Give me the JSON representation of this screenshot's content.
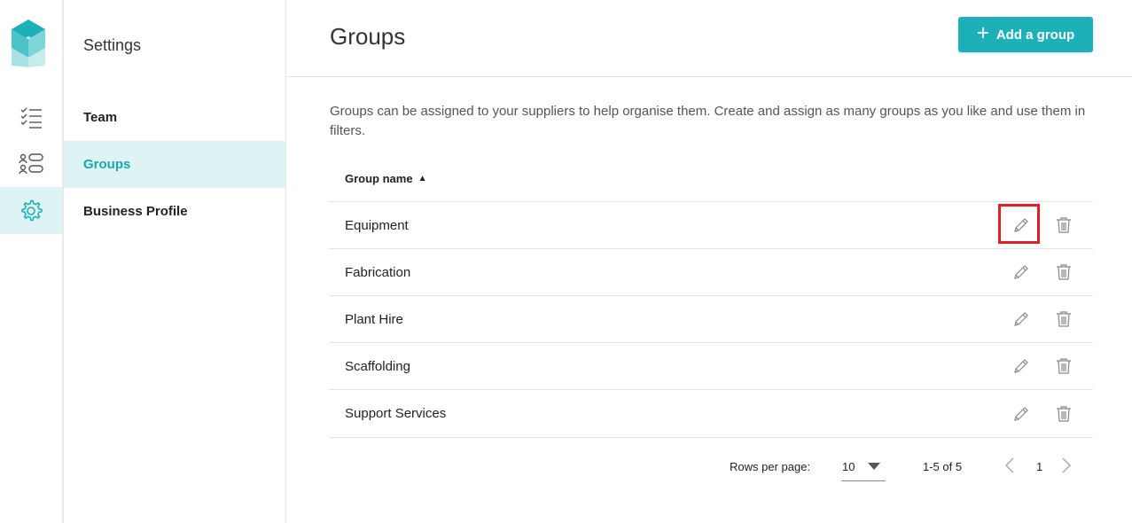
{
  "rail": {
    "items": [
      {
        "name": "tasks-icon"
      },
      {
        "name": "suppliers-icon"
      },
      {
        "name": "settings-icon"
      }
    ],
    "accent": "#1eb0b8"
  },
  "subnav": {
    "title": "Settings",
    "items": [
      {
        "label": "Team",
        "active": false
      },
      {
        "label": "Groups",
        "active": true
      },
      {
        "label": "Business Profile",
        "active": false
      }
    ]
  },
  "header": {
    "title": "Groups",
    "add_button_label": "Add a group"
  },
  "description": "Groups can be assigned to your suppliers to help organise them. Create and assign as many groups as you like and use them in filters.",
  "table": {
    "column_header": "Group name",
    "sort": "ascending",
    "rows": [
      {
        "name": "Equipment",
        "highlighted": true
      },
      {
        "name": "Fabrication"
      },
      {
        "name": "Plant Hire"
      },
      {
        "name": "Scaffolding"
      },
      {
        "name": "Support Services"
      }
    ]
  },
  "pagination": {
    "rows_per_page_label": "Rows per page:",
    "rows_per_page": "10",
    "range": "1-5 of 5",
    "page": "1"
  },
  "colors": {
    "accent": "#1eb0b8",
    "active_bg": "#ddf3f4",
    "highlight": "#e01e2c"
  }
}
